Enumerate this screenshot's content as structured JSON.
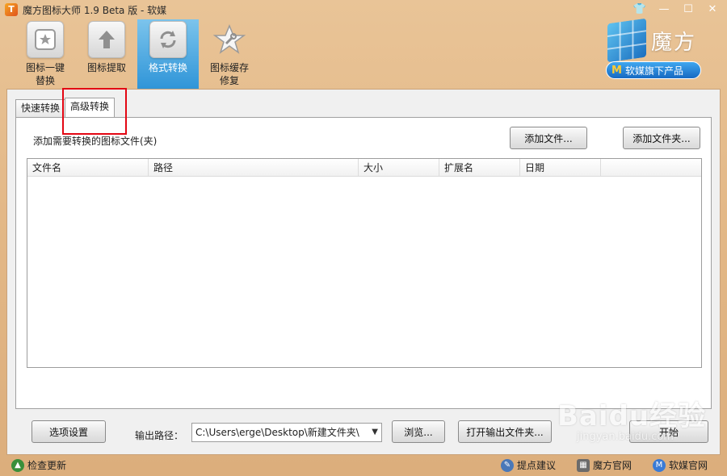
{
  "window": {
    "title": "魔方图标大师 1.9 Beta 版 - 软媒",
    "controls": [
      "👕",
      "—",
      "☐",
      "✕"
    ]
  },
  "toolbar": [
    {
      "label": "图标一键\n替换",
      "icon": "star-card-icon"
    },
    {
      "label": "图标提取",
      "icon": "up-arrow-icon"
    },
    {
      "label": "格式转换",
      "icon": "refresh-icon"
    },
    {
      "label": "图标缓存\n修复",
      "icon": "wrench-star-icon"
    }
  ],
  "brand": {
    "name": "魔方",
    "badge_letter": "M",
    "badge_text": "软媒旗下产品"
  },
  "tabs": {
    "quick": "快速转换",
    "advanced": "高级转换"
  },
  "main": {
    "instruction": "添加需要转换的图标文件(夹)",
    "add_file": "添加文件...",
    "add_folder": "添加文件夹...",
    "columns": [
      "文件名",
      "路径",
      "大小",
      "扩展名",
      "日期"
    ],
    "rows": []
  },
  "bottom": {
    "options": "选项设置",
    "output_label": "输出路径：",
    "output_path": "C:\\Users\\erge\\Desktop\\新建文件夹\\",
    "browse": "浏览...",
    "open_output": "打开输出文件夹...",
    "start": "开始"
  },
  "status": {
    "check_update": "检查更新",
    "suggest": "提点建议",
    "mofang_site": "魔方官网",
    "ruanmei_site": "软媒官网"
  },
  "watermark": {
    "main": "Baidu经验",
    "sub": "jingyan.baidu.com"
  }
}
